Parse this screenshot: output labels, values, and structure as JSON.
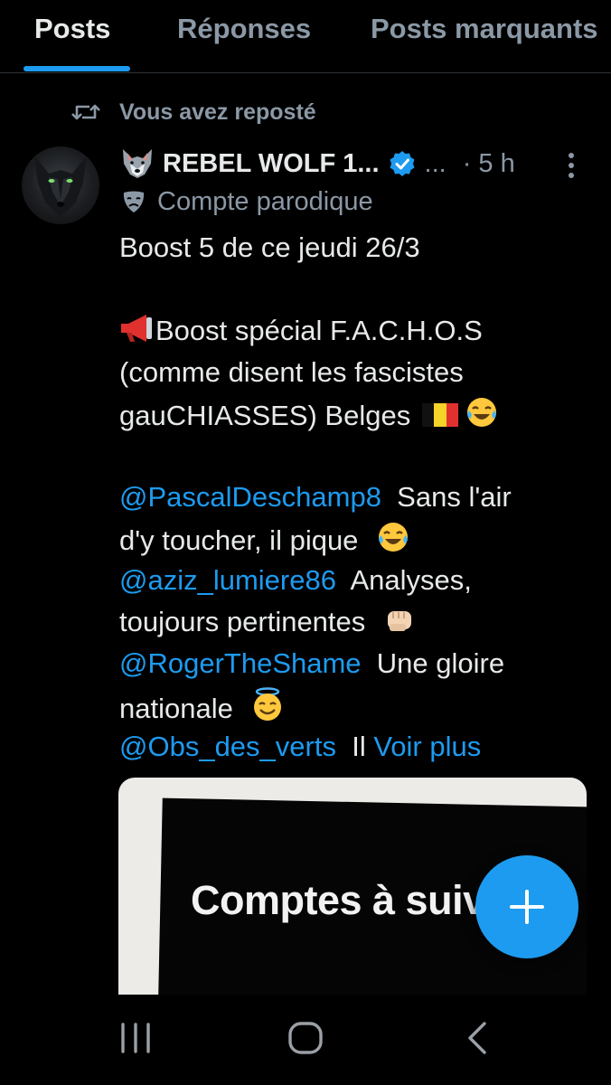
{
  "tabs": [
    {
      "label": "Posts",
      "active": true
    },
    {
      "label": "Réponses",
      "active": false
    },
    {
      "label": "Posts marquants",
      "active": false
    }
  ],
  "repost": {
    "icon": "repost-icon",
    "label": "Vous avez reposté"
  },
  "post": {
    "author_name": "REBEL WOLF 1...",
    "author_emoji": "wolf-emoji",
    "verified_icon": "verified-badge-icon",
    "handle_truncated": "...",
    "time": "· 5 h",
    "account_label": "Compte parodique",
    "body": {
      "line1": "Boost 5 de ce jeudi 26/3",
      "line2": "Boost spécial F.A.C.H.O.S",
      "line3": "(comme disent les fascistes",
      "line4": "gauCHIASSES) Belges",
      "line5_mention": "@PascalDeschamp8",
      "line5_text": "Sans l'air",
      "line6": "d'y toucher, il pique",
      "line7_mention": "@aziz_lumiere86",
      "line7_text": "Analyses,",
      "line8": "toujours pertinentes",
      "line9_mention": "@RogerTheShame",
      "line9_text": "Une gloire",
      "line10": "nationale",
      "line11_mention": "@Obs_des_verts",
      "line11_text": "Il",
      "see_more": "Voir plus"
    },
    "media_text": "Comptes à suiv"
  },
  "colors": {
    "accent": "#1d9bf0",
    "muted": "#8b98a5",
    "text": "#e7e9ea",
    "background": "#000000"
  },
  "fab": {
    "icon": "plus-icon"
  },
  "system_nav": {
    "recents_icon": "recents-icon",
    "home_icon": "home-circle-icon",
    "back_icon": "back-chevron-icon"
  }
}
